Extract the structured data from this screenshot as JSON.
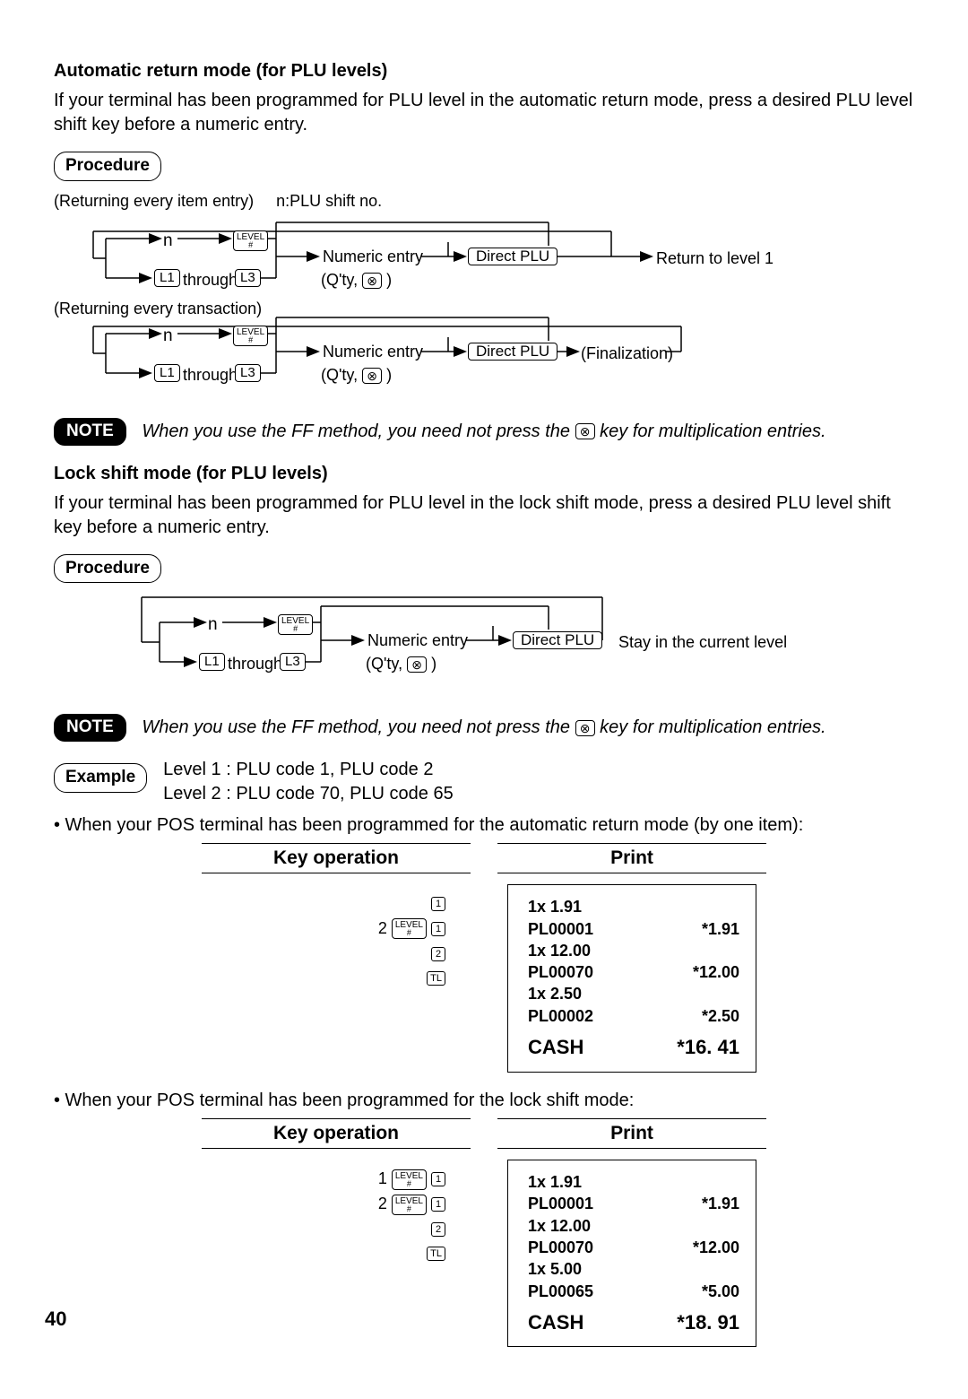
{
  "section1": {
    "heading": "Automatic return mode (for PLU levels)",
    "para": "If your terminal has been programmed for PLU level in the automatic return mode, press a desired PLU level shift key before a numeric entry.",
    "procedure": "Procedure",
    "returning_item": "(Returning every item entry)",
    "nplu": "n:PLU shift no.",
    "returning_txn": "(Returning every transaction)",
    "n": "n",
    "through": "through",
    "numeric_entry": "Numeric entry",
    "qty": "(Q'ty,",
    "qty_close": ")",
    "direct_plu": "Direct PLU",
    "return_level1": "Return to level 1",
    "finalization": "(Finalization)",
    "L1": "L1",
    "L3": "L3",
    "level": "LEVEL",
    "hash": "#"
  },
  "note": {
    "label": "NOTE",
    "text_before": "When you use the FF method,  you need not press the",
    "text_after": "key for multiplication entries."
  },
  "section2": {
    "heading": "Lock shift mode (for PLU levels)",
    "para": "If your terminal has been programmed for PLU level in the lock shift mode, press a desired PLU level shift key before a numeric entry.",
    "procedure": "Procedure",
    "stay": "Stay in the current level"
  },
  "example": {
    "label": "Example",
    "line1": "Level 1 : PLU code 1, PLU code 2",
    "line2": "Level 2 : PLU code 70, PLU code 65"
  },
  "bullets": {
    "b1": "• When your POS terminal has been programmed for the automatic return mode (by one item):",
    "b2": "• When your POS terminal has been programmed for the lock shift mode:"
  },
  "headers": {
    "keyop": "Key operation",
    "print": "Print"
  },
  "keyops1": {
    "r1_key": "1",
    "r2_num": "2",
    "r2_key": "1",
    "r3_key": "2",
    "r4_key": "TL"
  },
  "receipt1": {
    "l1": "1x  1.91",
    "l2a": "PL00001",
    "l2b": "*1.91",
    "l3": "1x  12.00",
    "l4a": "PL00070",
    "l4b": "*12.00",
    "l5": "1x  2.50",
    "l6a": "PL00002",
    "l6b": "*2.50",
    "cash": "CASH",
    "total": "*16. 41"
  },
  "keyops2": {
    "r1_num": "1",
    "r1_key": "1",
    "r2_num": "2",
    "r2_key": "1",
    "r3_key": "2",
    "r4_key": "TL"
  },
  "receipt2": {
    "l1": "1x  1.91",
    "l2a": "PL00001",
    "l2b": "*1.91",
    "l3": "1x  12.00",
    "l4a": "PL00070",
    "l4b": "*12.00",
    "l5": "1x  5.00",
    "l6a": "PL00065",
    "l6b": "*5.00",
    "cash": "CASH",
    "total": "*18. 91"
  },
  "page": "40"
}
